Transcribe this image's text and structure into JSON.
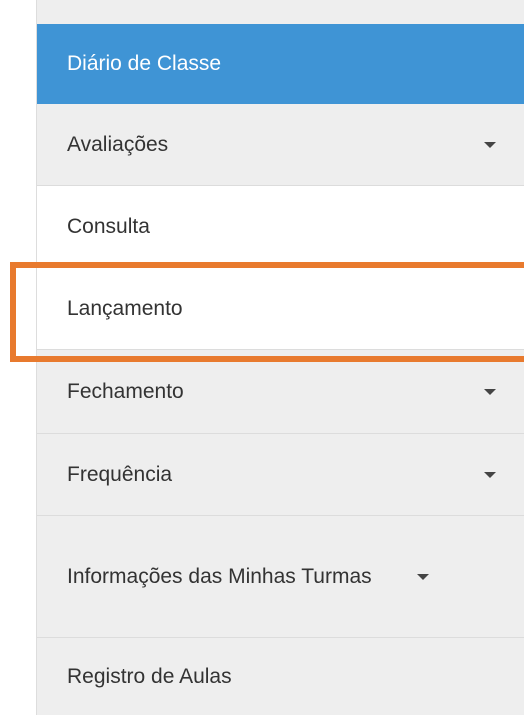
{
  "menu": {
    "header": "Diário de Classe",
    "items": [
      {
        "label": "Avaliações",
        "icon": "caret-down-icon"
      },
      {
        "label": "Consulta"
      },
      {
        "label": "Lançamento"
      },
      {
        "label": "Fechamento",
        "icon": "caret-down-icon"
      },
      {
        "label": "Frequência",
        "icon": "caret-down-icon"
      },
      {
        "label": "Informações das Minhas Turmas",
        "icon": "caret-down-icon"
      },
      {
        "label": "Registro de Aulas"
      }
    ]
  },
  "colors": {
    "header_bg": "#3f94d5",
    "highlight_border": "#e87a2e",
    "menu_bg": "#eeeeee",
    "submenu_bg": "#ffffff"
  }
}
